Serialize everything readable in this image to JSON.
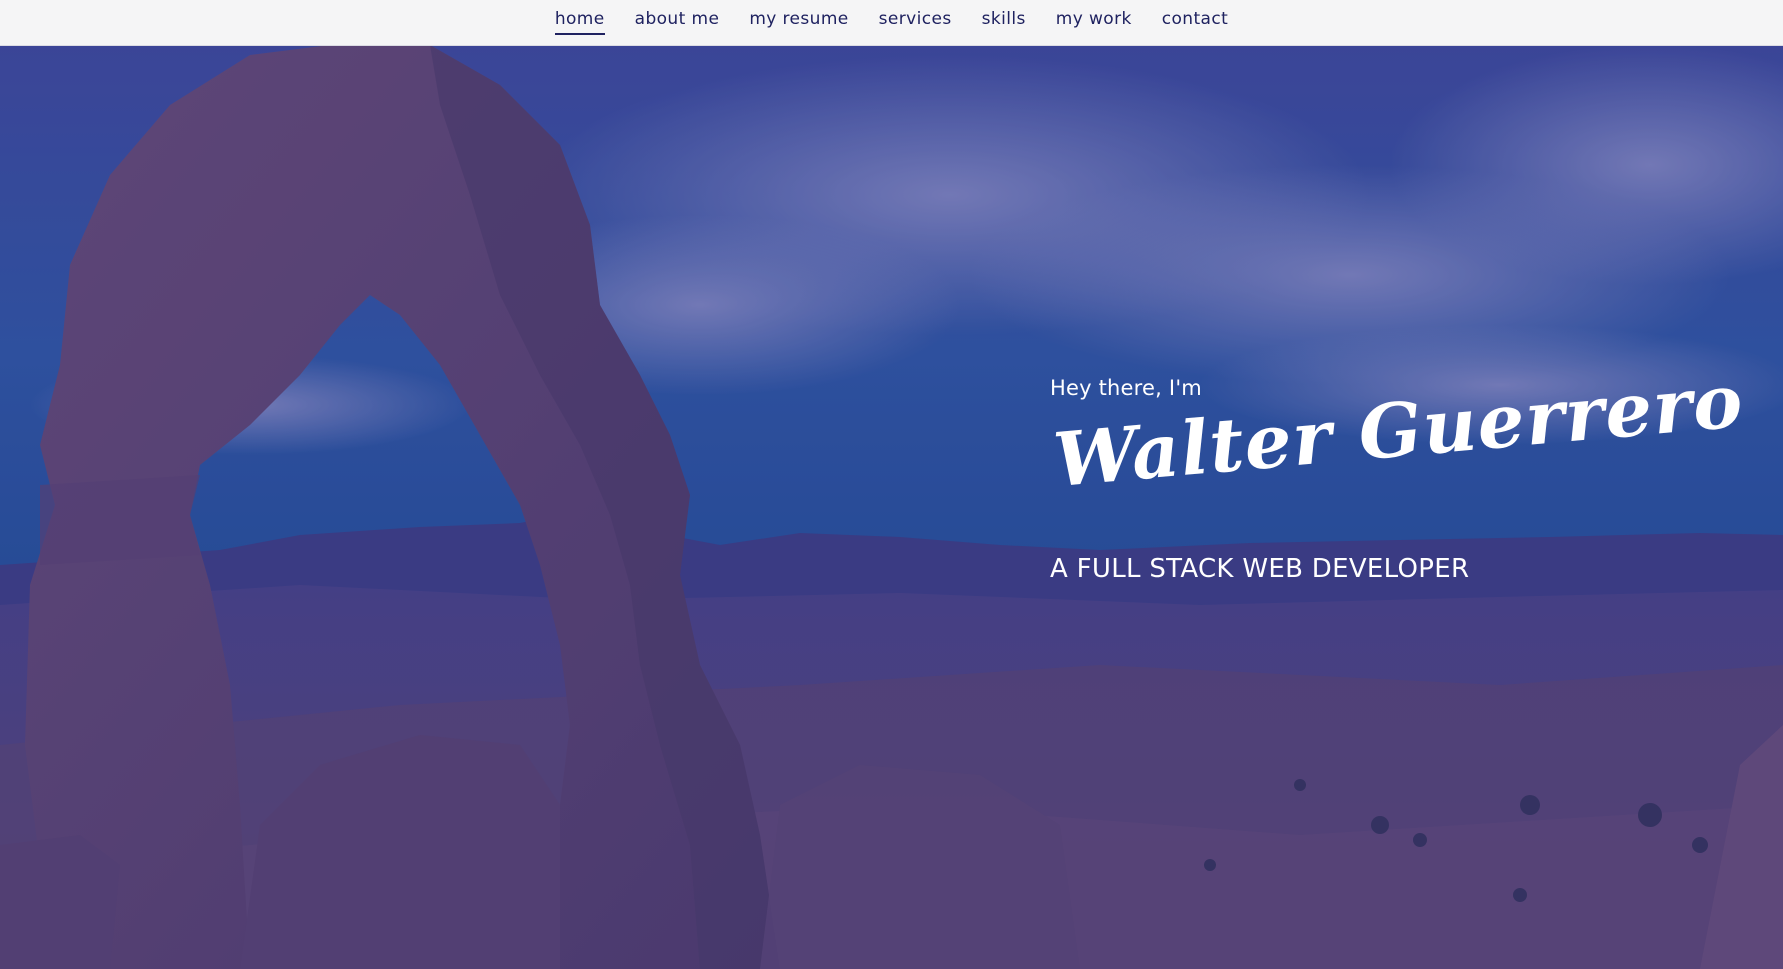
{
  "nav": {
    "items": [
      {
        "label": "home",
        "active": true
      },
      {
        "label": "about me",
        "active": false
      },
      {
        "label": "my resume",
        "active": false
      },
      {
        "label": "services",
        "active": false
      },
      {
        "label": "skills",
        "active": false
      },
      {
        "label": "my work",
        "active": false
      },
      {
        "label": "contact",
        "active": false
      }
    ]
  },
  "hero": {
    "greeting": "Hey there, I'm",
    "name": "Walter Guerrero",
    "role": "A FULL STACK WEB DEVELOPER",
    "background_image": "desert-rock-arch-landscape",
    "overlay_color": "#2b2a7a"
  },
  "colors": {
    "nav_background": "#f5f5f6",
    "nav_text": "#1f2260",
    "hero_text": "#ffffff"
  }
}
